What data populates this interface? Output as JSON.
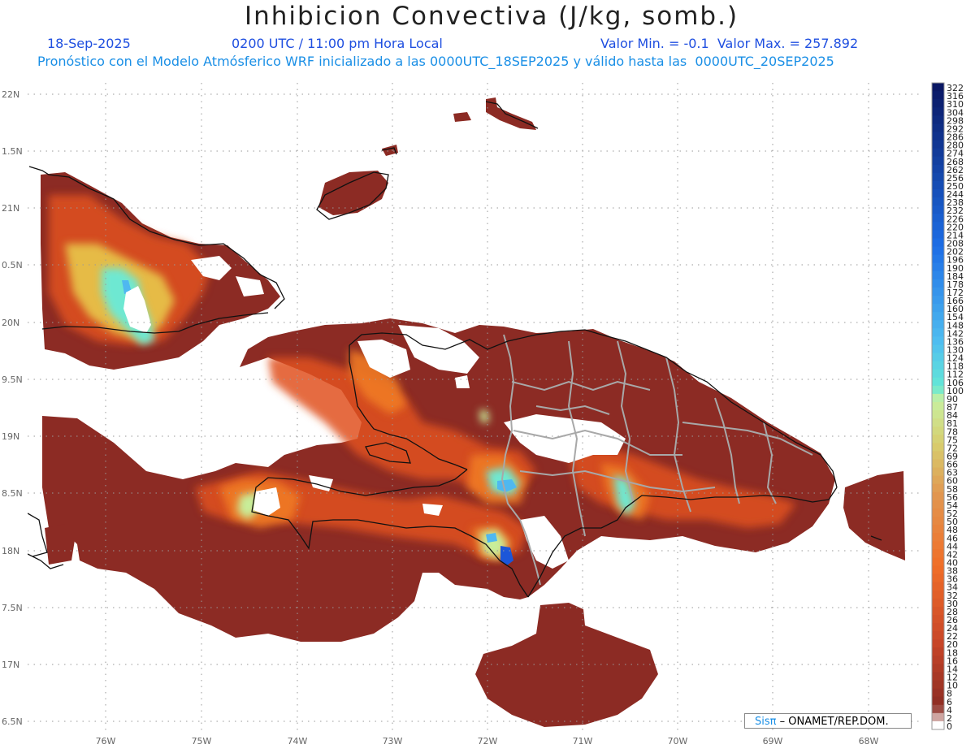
{
  "header": {
    "title": "Inhibicion Convectiva (J/kg, somb.)",
    "date": "18-Sep-2025",
    "time": "0200 UTC / 11:00 pm Hora Local",
    "minmax": "Valor Min. = -0.1  Valor Max. = 257.892",
    "subtitle": "Pronóstico con el Modelo Atmósferico WRF inicializado a las 0000UTC_18SEP2025 y válido hasta las  0000UTC_20SEP2025"
  },
  "map": {
    "lat_labels": [
      "22N",
      "1.5N",
      "21N",
      "0.5N",
      "20N",
      "9.5N",
      "19N",
      "8.5N",
      "18N",
      "7.5N",
      "17N",
      "6.5N"
    ],
    "lon_labels": [
      "76W",
      "75W",
      "74W",
      "73W",
      "72W",
      "71W",
      "70W",
      "69W",
      "68W"
    ],
    "colors": {
      "low": "#8c2b24",
      "mid": "#e0521c",
      "orange": "#f07a22",
      "yellow": "#e8c84a",
      "pale": "#c8ee9a",
      "cyan": "#6ee8d2",
      "sky": "#4fb8f0",
      "blue": "#1c56d8",
      "navy": "#0a1c6a",
      "coast": "#111111",
      "border": "#a8a8a8",
      "grid": "#9a9a9a"
    }
  },
  "colorbar": {
    "labels": [
      "322",
      "316",
      "310",
      "304",
      "298",
      "292",
      "286",
      "280",
      "274",
      "268",
      "262",
      "256",
      "250",
      "244",
      "238",
      "232",
      "226",
      "220",
      "214",
      "208",
      "202",
      "196",
      "190",
      "184",
      "178",
      "172",
      "166",
      "160",
      "154",
      "148",
      "142",
      "136",
      "130",
      "124",
      "118",
      "112",
      "106",
      "100",
      "90",
      "87",
      "84",
      "81",
      "78",
      "75",
      "72",
      "69",
      "66",
      "63",
      "60",
      "58",
      "56",
      "54",
      "52",
      "50",
      "48",
      "46",
      "44",
      "42",
      "40",
      "38",
      "36",
      "34",
      "32",
      "30",
      "28",
      "26",
      "24",
      "22",
      "20",
      "18",
      "16",
      "14",
      "12",
      "10",
      "8",
      "6",
      "4",
      "2",
      "0"
    ]
  },
  "credit": {
    "brand": "Sisπ",
    "text": "– ONAMET/REP.DOM."
  }
}
